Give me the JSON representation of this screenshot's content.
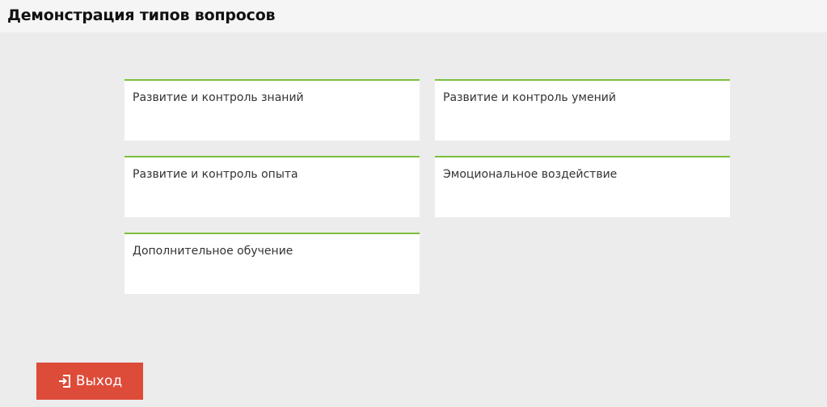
{
  "header": {
    "title": "Демонстрация типов вопросов"
  },
  "tiles": [
    {
      "label": "Развитие и контроль знаний"
    },
    {
      "label": "Развитие и контроль умений"
    },
    {
      "label": "Развитие и контроль опыта"
    },
    {
      "label": "Эмоциональное воздействие"
    },
    {
      "label": "Дополнительное обучение"
    }
  ],
  "exit_button": {
    "label": "Выход",
    "icon": "sign-out-icon"
  },
  "colors": {
    "accent_border": "#7bbf3c",
    "exit_button": "#dd4b39",
    "background": "#ececec"
  }
}
